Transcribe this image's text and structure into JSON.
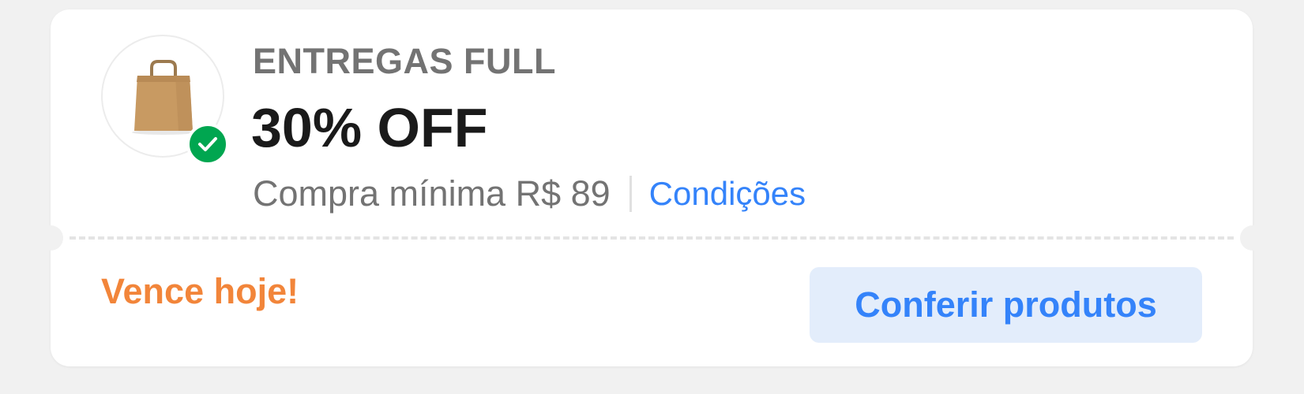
{
  "coupon": {
    "eyebrow": "ENTREGAS FULL",
    "headline": "30% OFF",
    "min_purchase": "Compra mínima R$ 89",
    "conditions_link": "Condições",
    "expiry": "Vence hoje!",
    "cta_label": "Conferir produtos",
    "image_icon": "paper-bag-icon",
    "badge_icon": "check-icon"
  },
  "colors": {
    "accent_blue": "#3483fa",
    "cta_background": "#e3edfb",
    "expiry_orange": "#f2853a",
    "badge_green": "#00a650"
  }
}
